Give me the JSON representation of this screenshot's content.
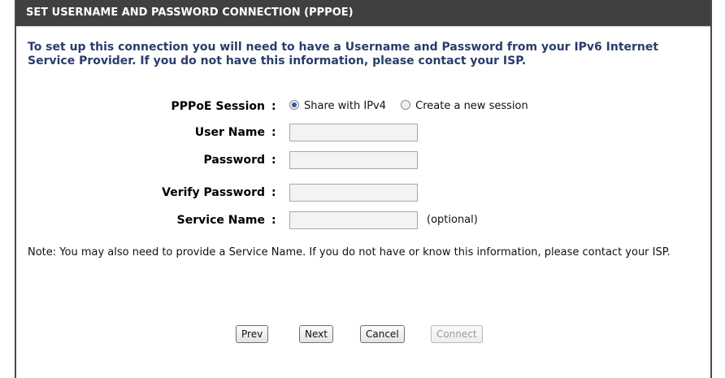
{
  "section": {
    "title": "SET USERNAME AND PASSWORD CONNECTION (PPPOE)",
    "intro": "To set up this connection you will need to have a Username and Password from your IPv6 Internet Service Provider. If you do not have this information, please contact your ISP."
  },
  "form": {
    "colon": ":",
    "pppoe_session": {
      "label": "PPPoE Session",
      "options": [
        "Share with IPv4",
        "Create a new session"
      ],
      "selected": "Share with IPv4"
    },
    "user_name": {
      "label": "User Name",
      "value": ""
    },
    "password": {
      "label": "Password",
      "value": ""
    },
    "verify_password": {
      "label": "Verify Password",
      "value": ""
    },
    "service_name": {
      "label": "Service Name",
      "value": "",
      "hint": "(optional)"
    }
  },
  "note": "Note: You may also need to provide a Service Name. If you do not have or know this information, please contact your ISP.",
  "buttons": {
    "prev": "Prev",
    "next": "Next",
    "cancel": "Cancel",
    "connect": "Connect"
  },
  "colors": {
    "titlebar_bg": "#404040",
    "intro_text": "#2a3d6b",
    "radio_selected": "#2b5ea8"
  }
}
